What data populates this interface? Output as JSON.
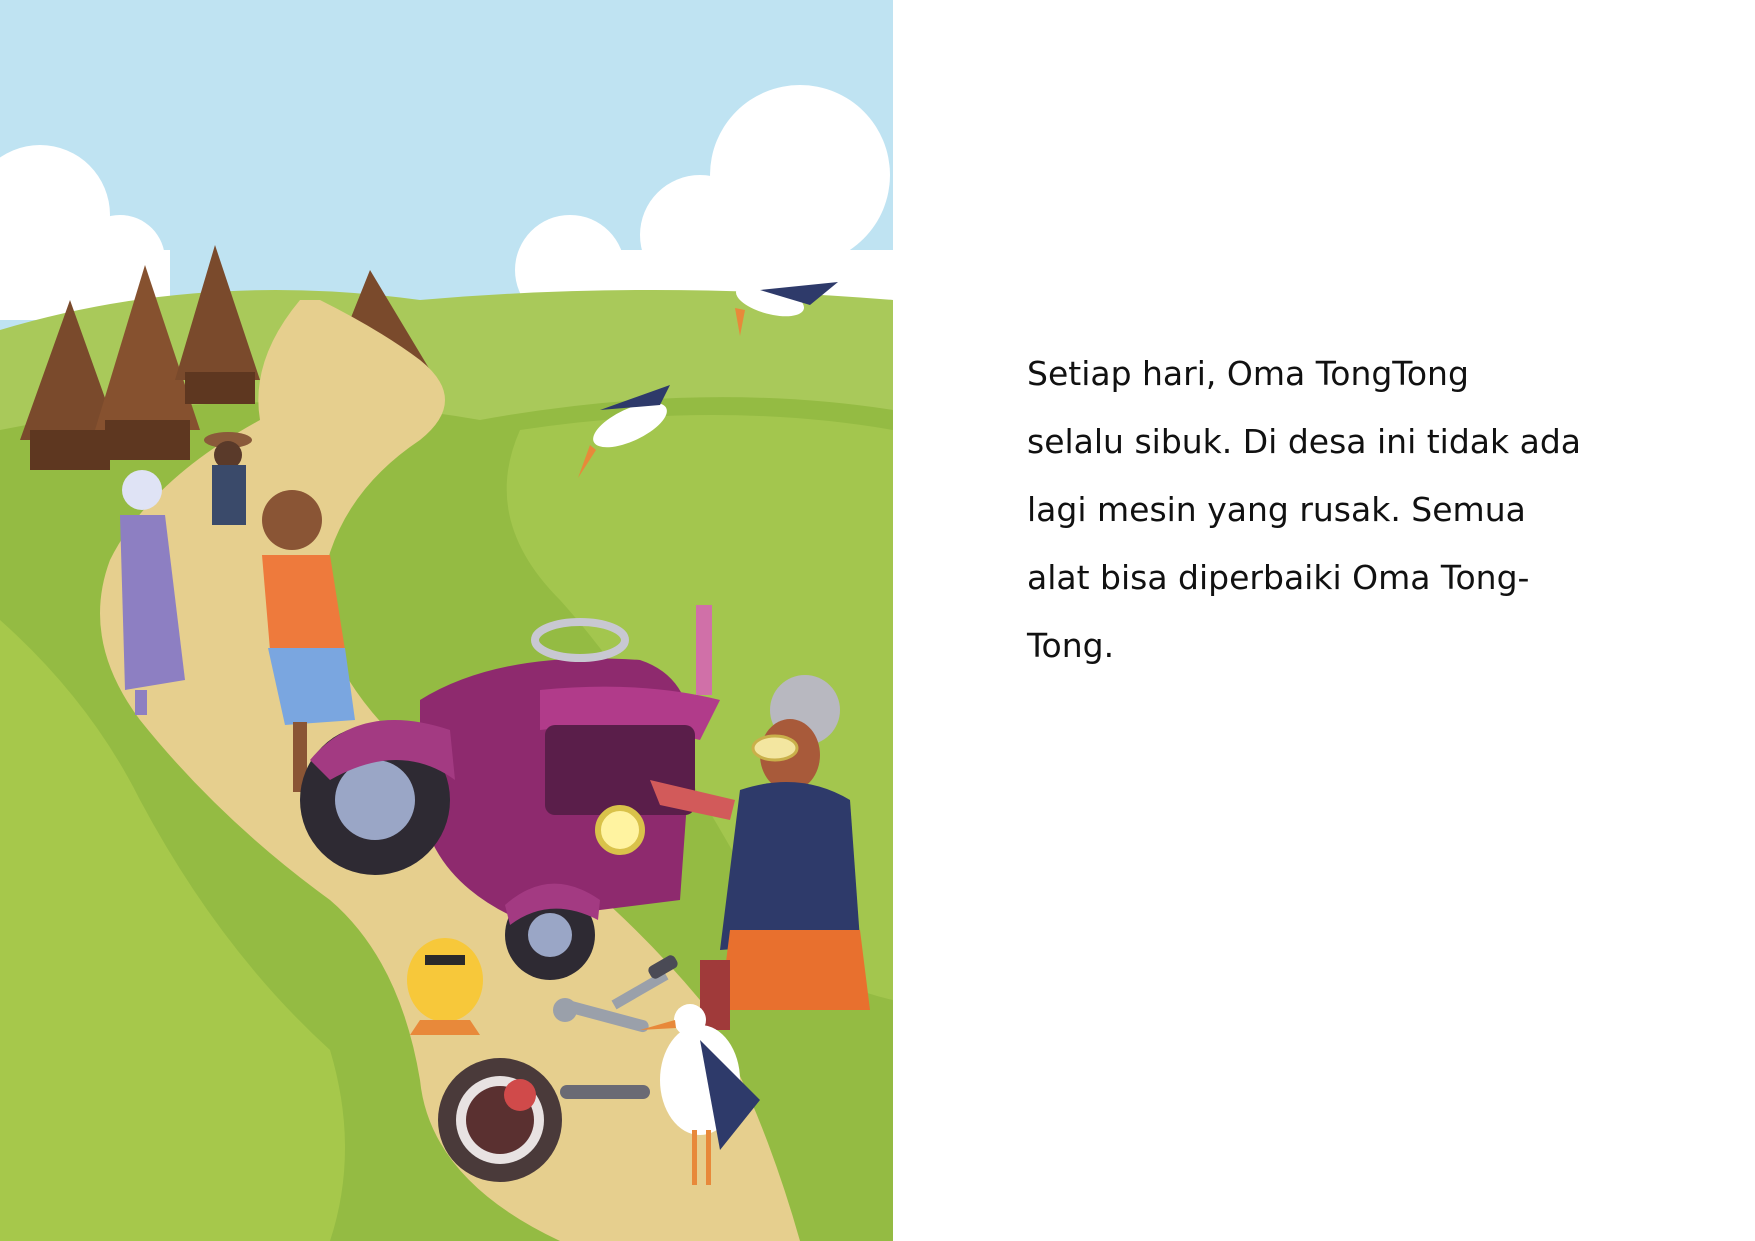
{
  "story": {
    "text": "Setiap hari, Oma TongTong\nselalu sibuk. Di desa ini tidak ada\nlagi mesin yang rusak. Semua\nalat bisa diperbaiki Oma Tong-\nTong."
  },
  "colors": {
    "sky": "#bfe3f2",
    "grass": "#9cc14a",
    "path": "#e6cf8e",
    "tractor": "#8e2a6e",
    "hut_roof": "#7a4a2c"
  },
  "illustration": {
    "icons": [
      "cloud-icon",
      "hut-icon",
      "stork-icon",
      "tractor-icon",
      "wrench-icon",
      "screwdriver-icon",
      "chick-icon",
      "turkey-icon"
    ]
  }
}
